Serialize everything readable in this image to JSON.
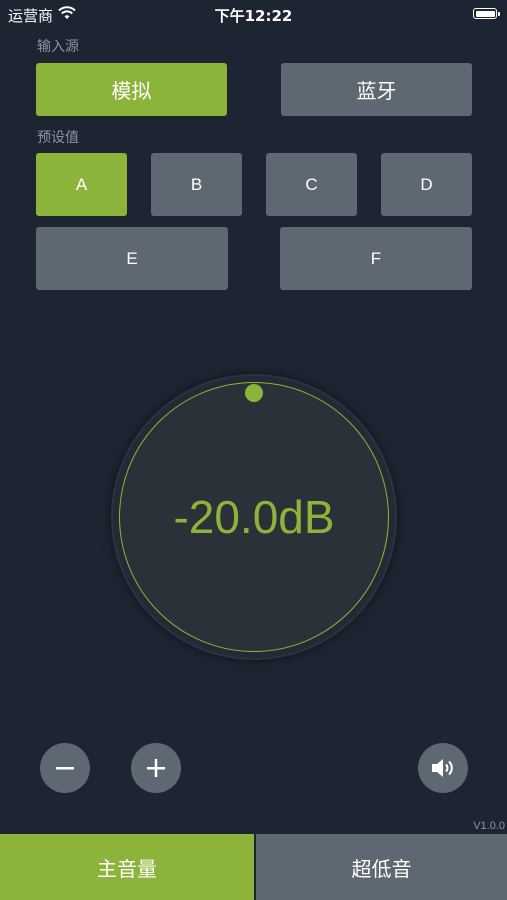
{
  "status_bar": {
    "carrier": "运营商",
    "time": "下午12:22"
  },
  "input_source": {
    "label": "输入源",
    "options": [
      {
        "label": "模拟",
        "active": true
      },
      {
        "label": "蓝牙",
        "active": false
      }
    ]
  },
  "presets": {
    "label": "预设值",
    "options": [
      {
        "label": "A",
        "active": true
      },
      {
        "label": "B",
        "active": false
      },
      {
        "label": "C",
        "active": false
      },
      {
        "label": "D",
        "active": false
      },
      {
        "label": "E",
        "active": false
      },
      {
        "label": "F",
        "active": false
      }
    ]
  },
  "dial": {
    "value": "-20.0dB"
  },
  "controls": {
    "decrease_icon": "minus-icon",
    "increase_icon": "plus-icon",
    "speaker_icon": "speaker-icon"
  },
  "version": "V1.0.0",
  "tabs": [
    {
      "label": "主音量",
      "active": true
    },
    {
      "label": "超低音",
      "active": false
    }
  ],
  "colors": {
    "background": "#1d2532",
    "accent": "#8db43a",
    "button": "#5d6873",
    "muted_text": "#8b95a2"
  }
}
